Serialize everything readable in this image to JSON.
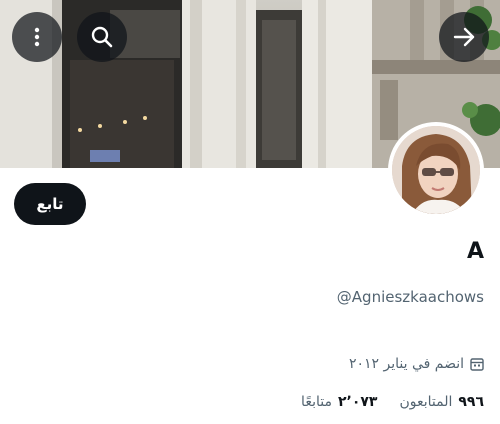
{
  "header": {
    "back_icon": "arrow-right-icon",
    "search_icon": "search-icon",
    "more_icon": "more-vertical-icon"
  },
  "profile": {
    "follow_label": "تابع",
    "display_name": "A",
    "handle": "@Agnieszkaachows",
    "joined": "انضم في يناير ٢٠١٢",
    "followers_count": "٩٩٦",
    "followers_label": "المتابعون",
    "following_count": "٢٬٠٧٣",
    "following_label": "متابعًا"
  },
  "colors": {
    "text_primary": "#0f1419",
    "text_secondary": "#536471",
    "button_bg": "#0f1419",
    "background": "#ffffff"
  }
}
